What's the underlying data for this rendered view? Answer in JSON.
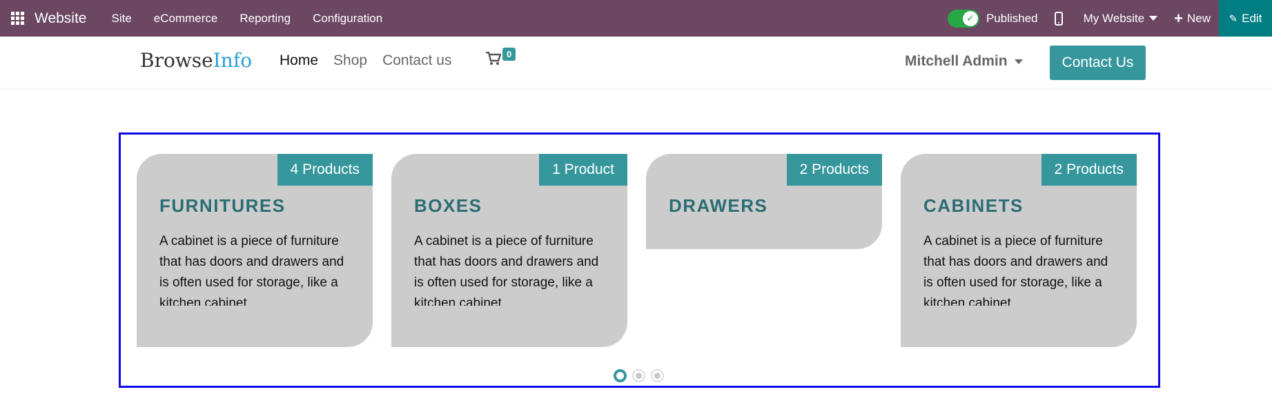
{
  "topbar": {
    "app_name": "Website",
    "menu": [
      "Site",
      "eCommerce",
      "Reporting",
      "Configuration"
    ],
    "published_label": "Published",
    "website_selector": "My Website",
    "new_label": "New",
    "edit_label": "Edit"
  },
  "site": {
    "logo_part1": "Browse",
    "logo_part2": "Info",
    "nav": [
      "Home",
      "Shop",
      "Contact us"
    ],
    "cart_count": "0",
    "user_name": "Mitchell Admin",
    "contact_button": "Contact Us"
  },
  "carousel": {
    "cards": [
      {
        "badge": "4 Products",
        "title": "FURNITURES",
        "description": "A cabinet is a piece of furniture that has doors and drawers and is often used for storage, like a kitchen cabinet"
      },
      {
        "badge": "1 Product",
        "title": "BOXES",
        "description": "A cabinet is a piece of furniture that has doors and drawers and is often used for storage, like a kitchen cabinet"
      },
      {
        "badge": "2 Products",
        "title": "DRAWERS",
        "description": ""
      },
      {
        "badge": "2 Products",
        "title": "CABINETS",
        "description": "A cabinet is a piece of furniture that has doors and drawers and is often used for storage, like a kitchen cabinet"
      }
    ],
    "page_count": 3,
    "active_page": 1
  },
  "colors": {
    "topbar": "#6b4762",
    "accent": "#35979c",
    "edit": "#017e84",
    "card_bg": "#cccccc",
    "card_title": "#2b6d74",
    "selection_border": "#0a0ae6"
  }
}
